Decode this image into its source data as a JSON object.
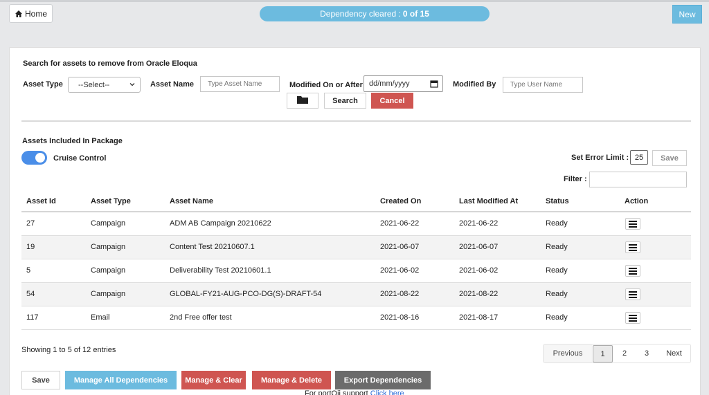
{
  "topbar": {
    "home_label": "Home",
    "dependency_prefix": "Dependency cleared :",
    "dependency_count": "0 of 15",
    "new_label": "New"
  },
  "search": {
    "title": "Search for assets to remove from Oracle Eloqua",
    "asset_type_label": "Asset Type",
    "asset_type_value": "--Select--",
    "asset_name_label": "Asset Name",
    "asset_name_placeholder": "Type Asset Name",
    "modified_label": "Modified On or After",
    "date_placeholder": "dd/mm/yyyy",
    "modified_by_label": "Modified By",
    "user_placeholder": "Type User Name",
    "search_label": "Search",
    "cancel_label": "Cancel"
  },
  "package": {
    "title": "Assets Included In Package",
    "cruise_label": "Cruise Control",
    "cruise_on": true,
    "error_limit_label": "Set Error Limit :",
    "error_limit_value": "25",
    "save_limit_label": "Save",
    "filter_label": "Filter :"
  },
  "table": {
    "headers": [
      "Asset Id",
      "Asset Type",
      "Asset Name",
      "Created On",
      "Last Modified At",
      "Status",
      "Action"
    ],
    "rows": [
      [
        "27",
        "Campaign",
        "ADM AB Campaign 20210622",
        "2021-06-22",
        "2021-06-22",
        "Ready"
      ],
      [
        "19",
        "Campaign",
        "Content Test 20210607.1",
        "2021-06-07",
        "2021-06-07",
        "Ready"
      ],
      [
        "5",
        "Campaign",
        "Deliverability Test 20210601.1",
        "2021-06-02",
        "2021-06-02",
        "Ready"
      ],
      [
        "54",
        "Campaign",
        "GLOBAL-FY21-AUG-PCO-DG(S)-DRAFT-54",
        "2021-08-22",
        "2021-08-22",
        "Ready"
      ],
      [
        "117",
        "Email",
        "2nd Free offer test",
        "2021-08-16",
        "2021-08-17",
        "Ready"
      ]
    ]
  },
  "footer": {
    "showing": "Showing 1 to 5 of 12 entries",
    "pager": {
      "prev": "Previous",
      "pages": [
        "1",
        "2",
        "3"
      ],
      "next": "Next",
      "current": "1"
    },
    "save": "Save",
    "manage_all": "Manage All Dependencies",
    "manage_clear": "Manage & Clear",
    "manage_delete": "Manage & Delete",
    "export": "Export Dependencies",
    "support_text": "For portQii support",
    "support_link": "Click here"
  },
  "colors": {
    "accent_blue": "#6cbbdf",
    "danger_red": "#cf5551",
    "toggle_blue": "#4a8ee8",
    "dark_gray": "#6b6b6b"
  }
}
